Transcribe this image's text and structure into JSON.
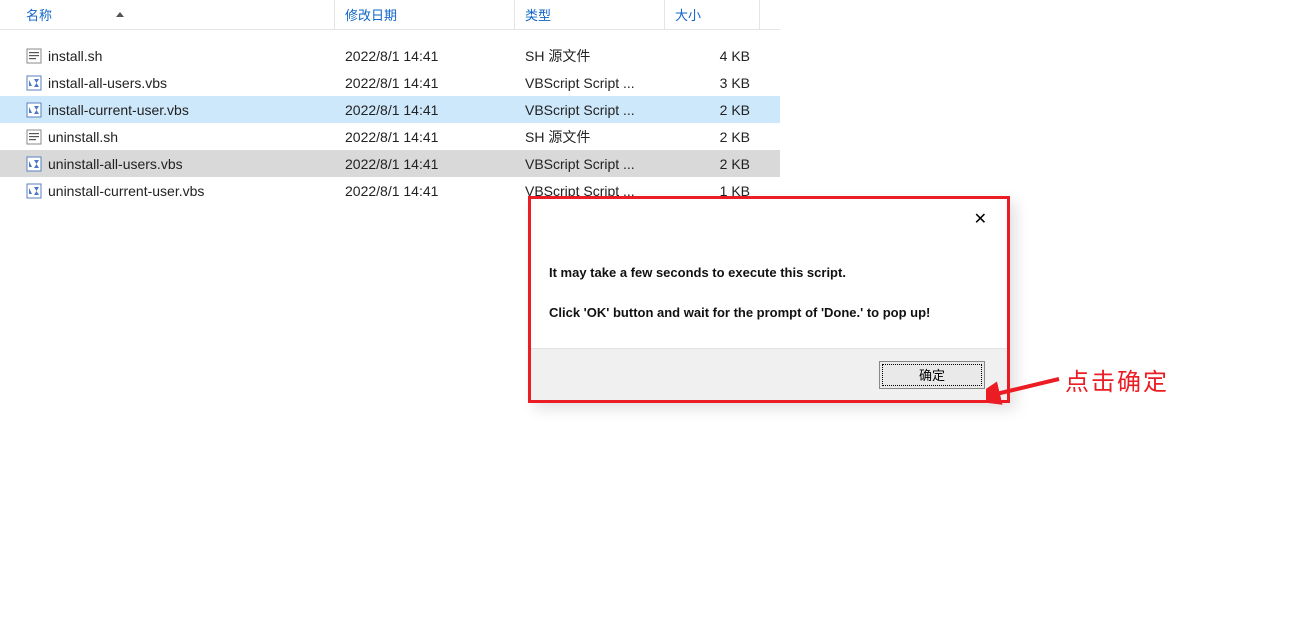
{
  "columns": {
    "name": "名称",
    "date": "修改日期",
    "type": "类型",
    "size": "大小"
  },
  "files": [
    {
      "name": "install.sh",
      "date": "2022/8/1 14:41",
      "type": "SH 源文件",
      "size": "4 KB",
      "icon": "sh",
      "state": ""
    },
    {
      "name": "install-all-users.vbs",
      "date": "2022/8/1 14:41",
      "type": "VBScript Script ...",
      "size": "3 KB",
      "icon": "vbs",
      "state": ""
    },
    {
      "name": "install-current-user.vbs",
      "date": "2022/8/1 14:41",
      "type": "VBScript Script ...",
      "size": "2 KB",
      "icon": "vbs",
      "state": "selected"
    },
    {
      "name": "uninstall.sh",
      "date": "2022/8/1 14:41",
      "type": "SH 源文件",
      "size": "2 KB",
      "icon": "sh",
      "state": ""
    },
    {
      "name": "uninstall-all-users.vbs",
      "date": "2022/8/1 14:41",
      "type": "VBScript Script ...",
      "size": "2 KB",
      "icon": "vbs",
      "state": "hover"
    },
    {
      "name": "uninstall-current-user.vbs",
      "date": "2022/8/1 14:41",
      "type": "VBScript Script ...",
      "size": "1 KB",
      "icon": "vbs",
      "state": ""
    }
  ],
  "dialog": {
    "line1": "It may take a few seconds to execute this script.",
    "line2": "Click 'OK' button and wait for the prompt of 'Done.' to pop up!",
    "ok": "确定"
  },
  "annotation": "点击确定"
}
